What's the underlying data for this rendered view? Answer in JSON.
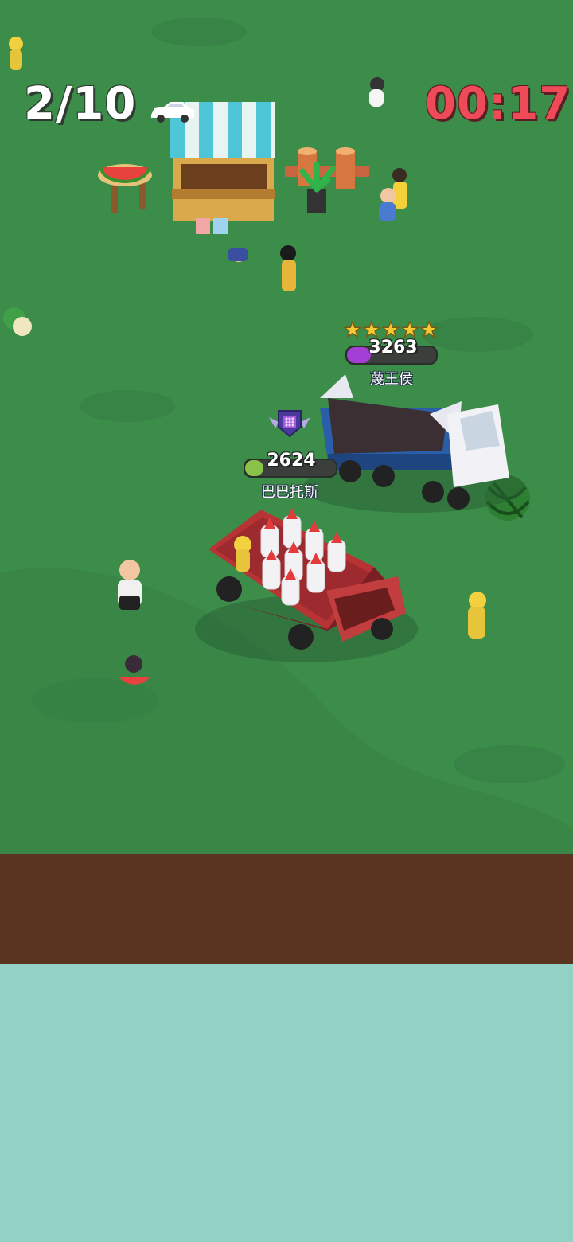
{
  "hud": {
    "counter": "2/10",
    "timer": "00:17",
    "timer_color": "#ef4a57",
    "car_icon": "car-icon"
  },
  "opponent": {
    "score": "3263",
    "name": "蔑王侯",
    "stars": 5,
    "bar_fraction": 0.27,
    "bar_color": "#a43fd6",
    "vehicle": "dump-truck"
  },
  "player": {
    "score": "2624",
    "name": "巴巴托斯",
    "bar_fraction": 0.2,
    "bar_color": "#8bc34a",
    "rank_badge": "shield-badge-icon",
    "vehicle": "red-pickup-with-bottles"
  },
  "colors": {
    "grass": "#3c8c4a",
    "dirt": "#5a3421",
    "water": "#93d1c4"
  }
}
